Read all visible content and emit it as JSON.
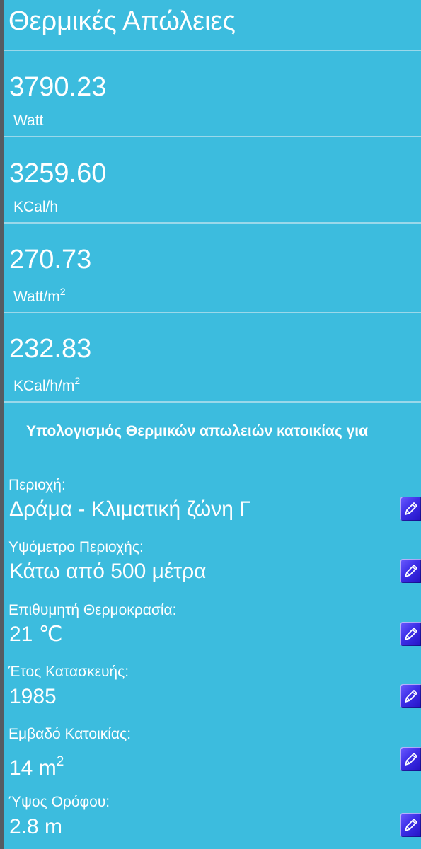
{
  "header": {
    "title": "Θερμικές Απώλειες"
  },
  "results": [
    {
      "value": "3790.23",
      "unit": "Watt",
      "unit_sup": ""
    },
    {
      "value": "3259.60",
      "unit": "KCal/h",
      "unit_sup": ""
    },
    {
      "value": "270.73",
      "unit": "Watt/m",
      "unit_sup": "2"
    },
    {
      "value": "232.83",
      "unit": "KCal/h/m",
      "unit_sup": "2"
    }
  ],
  "section": {
    "heading": "Υπολογισμός Θερμικών απωλειών κατοικίας για"
  },
  "fields": [
    {
      "label": "Περιοχή:",
      "value": "Δράμα - Κλιματική ζώνη Γ",
      "value_sup": ""
    },
    {
      "label": "Υψόμετρο Περιοχής:",
      "value": "Κάτω από 500 μέτρα",
      "value_sup": ""
    },
    {
      "label": "Επιθυμητή Θερμοκρασία:",
      "value": "21 ℃",
      "value_sup": ""
    },
    {
      "label": "Έτος Κατασκευής:",
      "value": "1985",
      "value_sup": ""
    },
    {
      "label": "Εμβαδό Κατοικίας:",
      "value": "14 m",
      "value_sup": "2"
    },
    {
      "label": "Ύψος Ορόφου:",
      "value": "2.8 m",
      "value_sup": ""
    }
  ],
  "icons": {
    "edit": "pencil-icon"
  },
  "colors": {
    "background": "#3cbcde",
    "divider": "#9ad8ea",
    "edit_button": "#3d2fe8",
    "text": "#ffffff"
  }
}
